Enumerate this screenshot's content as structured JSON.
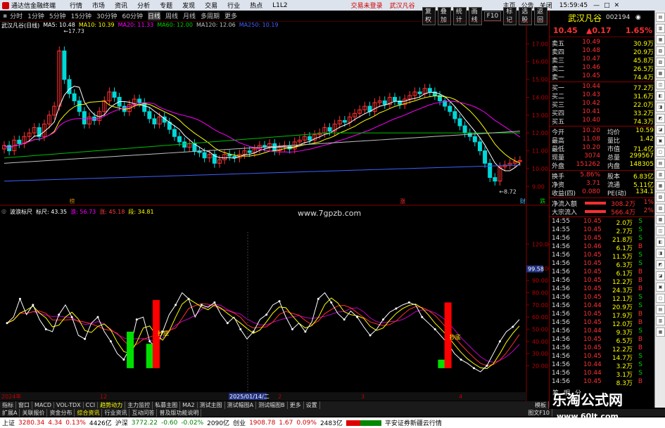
{
  "app": {
    "title": "通达信金融终端",
    "menus": [
      "行情",
      "市场",
      "资讯",
      "分析",
      "专题",
      "发现",
      "交易",
      "行业",
      "热点",
      "L1L2"
    ],
    "trade_login": "交易未登录",
    "stock_short": "武汉凡谷",
    "window_menus": [
      "主页",
      "公告",
      "关闭"
    ],
    "clock": "15:59:45"
  },
  "tabs": [
    "分时",
    "1分钟",
    "5分钟",
    "15分钟",
    "30分钟",
    "60分钟",
    "日线",
    "周线",
    "月线",
    "多周期",
    "更多"
  ],
  "toolbar": [
    "复权",
    "叠加",
    "统计",
    "画线",
    "F10",
    "标记",
    "选股",
    "返回"
  ],
  "chart_title": "武汉凡谷(日线)",
  "ma": {
    "ma5": "MA5: 10.48",
    "ma10": "MA10: 10.39",
    "ma20": "MA20: 11.33",
    "ma60": "MA60: 12.00",
    "ma120": "MA120: 12.06",
    "ma250": "MA250: 10.19"
  },
  "price_annot": {
    "high": "17.73",
    "low": "8.72",
    "marks": [
      "榜",
      "涨",
      "财",
      "跌"
    ]
  },
  "price_axis": [
    "17.00",
    "16.00",
    "15.00",
    "14.00",
    "13.00",
    "12.00",
    "11.00",
    "10.00",
    "9.00"
  ],
  "osc_legend": {
    "name": "波浪标尺",
    "label1": "标尺: 43.35",
    "label2": "浪: 56.73",
    "label3": "涨: 45.18",
    "label4": "段: 34.81"
  },
  "osc_axis": [
    "120.00",
    "100.00",
    "90.00",
    "80.00",
    "70.00",
    "60.00",
    "50.00",
    "40.00",
    "30.00",
    "20.00"
  ],
  "osc_tag": "99.58",
  "osc_signals": [
    "抄底",
    "抄底"
  ],
  "date_axis": {
    "year": "2024年",
    "m12": "12",
    "sel": "2025/01/14/二",
    "m2": "2",
    "m3": "3",
    "m4": "4"
  },
  "watermark1": "www.7gpzb.com",
  "quote": {
    "name": "武汉凡谷",
    "code": "002194",
    "price": "10.45",
    "change": "▲0.17",
    "pct": "1.65%",
    "asks": [
      {
        "l": "卖五",
        "p": "10.49",
        "v": "30.9万"
      },
      {
        "l": "卖四",
        "p": "10.48",
        "v": "20.9万"
      },
      {
        "l": "卖三",
        "p": "10.47",
        "v": "45.8万"
      },
      {
        "l": "卖二",
        "p": "10.46",
        "v": "26.5万"
      },
      {
        "l": "卖一",
        "p": "10.45",
        "v": "74.4万"
      }
    ],
    "bids": [
      {
        "l": "买一",
        "p": "10.44",
        "v": "77.2万"
      },
      {
        "l": "买二",
        "p": "10.43",
        "v": "31.6万"
      },
      {
        "l": "买三",
        "p": "10.42",
        "v": "22.0万"
      },
      {
        "l": "买四",
        "p": "10.41",
        "v": "33.2万"
      },
      {
        "l": "买五",
        "p": "10.40",
        "v": "74.3万"
      }
    ],
    "stats": [
      {
        "a": "今开",
        "b": "10.20",
        "c": "均价",
        "d": "10.59"
      },
      {
        "a": "最高",
        "b": "11.08",
        "c": "量比",
        "d": "1.42"
      },
      {
        "a": "最低",
        "b": "10.20",
        "c": "市值",
        "d": "71.4亿"
      },
      {
        "a": "现量",
        "b": "3074",
        "c": "总量",
        "d": "299567"
      },
      {
        "a": "外盘",
        "b": "151262",
        "c": "内盘",
        "d": "148305"
      }
    ],
    "stats2": [
      {
        "a": "换手",
        "b": "5.86%",
        "c": "股本",
        "d": "6.83亿"
      },
      {
        "a": "净资",
        "b": "3.71",
        "c": "流通",
        "d": "5.11亿"
      },
      {
        "a": "收益(四)",
        "b": "0.080",
        "c": "PE(动)",
        "d": "134.1"
      }
    ],
    "flow": [
      {
        "a": "净流入额",
        "b": "308.2万",
        "c": "1%"
      },
      {
        "a": "大宗流入",
        "b": "566.4万",
        "c": "2%"
      }
    ],
    "ticks": [
      {
        "t": "14:55",
        "p": "10.45",
        "v": "2.0万",
        "d": "S"
      },
      {
        "t": "14:55",
        "p": "10.45",
        "v": "2.7万",
        "d": "S"
      },
      {
        "t": "14:56",
        "p": "10.45",
        "v": "21.8万",
        "d": "S"
      },
      {
        "t": "14:56",
        "p": "10.46",
        "v": "6.1万",
        "d": "B"
      },
      {
        "t": "14:56",
        "p": "10.45",
        "v": "11.5万",
        "d": "S"
      },
      {
        "t": "14:56",
        "p": "10.45",
        "v": "6.3万",
        "d": "S"
      },
      {
        "t": "14:56",
        "p": "10.45",
        "v": "6.1万",
        "d": "B"
      },
      {
        "t": "14:56",
        "p": "10.45",
        "v": "12.2万",
        "d": "B"
      },
      {
        "t": "14:56",
        "p": "10.45",
        "v": "24.3万",
        "d": "B"
      },
      {
        "t": "14:56",
        "p": "10.45",
        "v": "12.1万",
        "d": "S"
      },
      {
        "t": "14:56",
        "p": "10.44",
        "v": "20.9万",
        "d": "S"
      },
      {
        "t": "14:56",
        "p": "10.45",
        "v": "17.9万",
        "d": "B"
      },
      {
        "t": "14:56",
        "p": "10.45",
        "v": "12.0万",
        "d": "B"
      },
      {
        "t": "14:56",
        "p": "10.44",
        "v": "9.3万",
        "d": "S"
      },
      {
        "t": "14:56",
        "p": "10.45",
        "v": "6.5万",
        "d": "B"
      },
      {
        "t": "14:56",
        "p": "10.45",
        "v": "12.2万",
        "d": "B"
      },
      {
        "t": "14:56",
        "p": "10.45",
        "v": "14.7万",
        "d": "S"
      },
      {
        "t": "14:56",
        "p": "10.44",
        "v": "3.2万",
        "d": "S"
      },
      {
        "t": "14:56",
        "p": "10.44",
        "v": "3.1万",
        "d": "S"
      },
      {
        "t": "14:56",
        "p": "10.45",
        "v": "8.3万",
        "d": "B"
      }
    ],
    "foot_tabs": [
      "筹",
      "明",
      "分"
    ]
  },
  "btabs": [
    "指标",
    "窗口",
    "MACD",
    "VOL-TDX",
    "CCI",
    "趋势动力",
    "主力监控",
    "私募主图",
    "MA2",
    "测试主图",
    "测试幅图A",
    "测试幅图B",
    "更多",
    "设置"
  ],
  "btabs_right": "模板",
  "mtabs": [
    "扩展A",
    "关联报价",
    "资金分布",
    "综合资讯",
    "行业资讯",
    "互动问答",
    "普及版功能说明"
  ],
  "mtabs_right": "图文F10",
  "status": {
    "sh": "上证",
    "sh_v": "3280.34",
    "sh_c": "4.34",
    "sh_p": "0.13%",
    "sh_a": "4426亿",
    "sz": "沪深",
    "sz_v": "3772.22",
    "sz_c": "-0.60",
    "sz_p": "-0.02%",
    "sz_a": "2090亿",
    "cy": "创业",
    "cy_v": "1908.78",
    "cy_c": "1.67",
    "cy_p": "0.09%",
    "cy_a": "2483亿",
    "broker": "平安证券新疆云行情"
  },
  "wm_site": "乐淘公式网",
  "wm_url": "www.60lt.com",
  "colors": {
    "up": "#ff3030",
    "down": "#00d8d8",
    "ma5": "#ffffff",
    "ma10": "#ffff00",
    "ma20": "#ff00ff",
    "ma60": "#00c000",
    "ma120": "#c0c0c0",
    "ma250": "#4060ff"
  },
  "chart_data": {
    "type": "candlestick",
    "closes": [
      11.3,
      11.0,
      11.6,
      11.4,
      11.8,
      12.0,
      12.3,
      11.8,
      12.5,
      13.0,
      13.5,
      16.6,
      15.0,
      14.2,
      13.8,
      13.2,
      12.5,
      12.9,
      12.7,
      13.2,
      13.8,
      14.3,
      14.0,
      13.5,
      13.2,
      13.6,
      13.9,
      13.7,
      13.2,
      12.8,
      12.5,
      12.9,
      12.6,
      12.2,
      11.8,
      11.5,
      11.2,
      11.4,
      11.0,
      10.9,
      10.6,
      10.8,
      10.3,
      10.5,
      10.8,
      10.7,
      10.6,
      10.8,
      11.0,
      10.9,
      11.1,
      11.3,
      11.2,
      11.4,
      11.0,
      11.2,
      11.3,
      11.1,
      11.5,
      11.6,
      11.8,
      11.6,
      11.9,
      12.0,
      12.3,
      12.1,
      12.5,
      12.7,
      12.6,
      12.9,
      13.1,
      13.3,
      13.5,
      13.2,
      13.7,
      13.8,
      13.6,
      14.0,
      13.8,
      13.6,
      13.9,
      14.1,
      14.3,
      14.2,
      14.5,
      14.3,
      14.1,
      13.8,
      13.5,
      13.2,
      12.8,
      12.4,
      12.0,
      11.8,
      11.5,
      11.0,
      10.3,
      9.5,
      9.3,
      10.1,
      10.2,
      10.3,
      10.4,
      10.45
    ],
    "ma60_level": 12.0,
    "ma250_level": 10.19,
    "osc_values": [
      55,
      60,
      75,
      62,
      70,
      58,
      50,
      48,
      62,
      70,
      60,
      45,
      42,
      55,
      60,
      48,
      40,
      30,
      25,
      35,
      58,
      60,
      40,
      35,
      48,
      62,
      70,
      80,
      75,
      60,
      70,
      68,
      72,
      62,
      55,
      60,
      50,
      42,
      48,
      58,
      62,
      70,
      73,
      60,
      50,
      55,
      48,
      56,
      75,
      80,
      72,
      63,
      58,
      65,
      60,
      52,
      45,
      50,
      58,
      64,
      67,
      70,
      72,
      70,
      60,
      55,
      50,
      44,
      38,
      30,
      25,
      22,
      18,
      15,
      20,
      30,
      40,
      48,
      52,
      58
    ]
  }
}
